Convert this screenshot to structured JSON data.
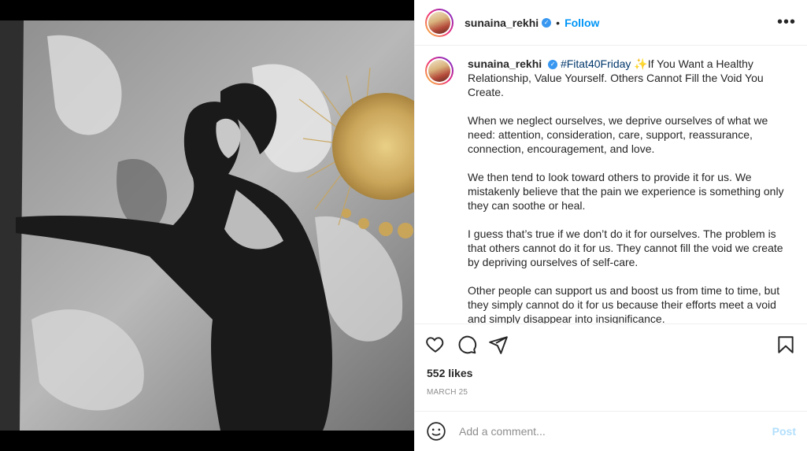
{
  "post": {
    "username": "sunaina_rekhi",
    "follow_label": "Follow",
    "dot": "•",
    "more_label": "•••",
    "caption": {
      "username": "sunaina_rekhi",
      "hashtag": "#Fitat40Friday",
      "emoji": "✨",
      "first_line": "If You Want a Healthy Relationship, Value Yourself. Others Cannot Fill the Void You Create.",
      "paragraphs": [
        "When we neglect ourselves, we deprive ourselves of what we need: attention, consideration, care, support, reassurance, connection, encouragement, and love.",
        "We then tend to look toward others to provide it for us. We mistakenly believe that the pain we experience is something only they can soothe or heal.",
        "I guess that’s true if we don’t do it for ourselves. The problem is that others cannot do it for us. They cannot fill the void we create by depriving ourselves of self-care.",
        "Other people can support us and boost us from time to time, but they simply cannot do it for us because their efforts meet a void and simply disappear into insignificance."
      ]
    },
    "likes": "552 likes",
    "date": "MARCH 25",
    "comment_placeholder": "Add a comment...",
    "post_label": "Post"
  },
  "colors": {
    "follow": "#0095f6",
    "verified": "#3897f0",
    "hashtag": "#00376b",
    "post_disabled": "#b2dffc"
  },
  "icons": [
    "heart-icon",
    "comment-icon",
    "share-icon",
    "bookmark-icon",
    "emoji-icon",
    "more-icon",
    "verified-icon"
  ]
}
